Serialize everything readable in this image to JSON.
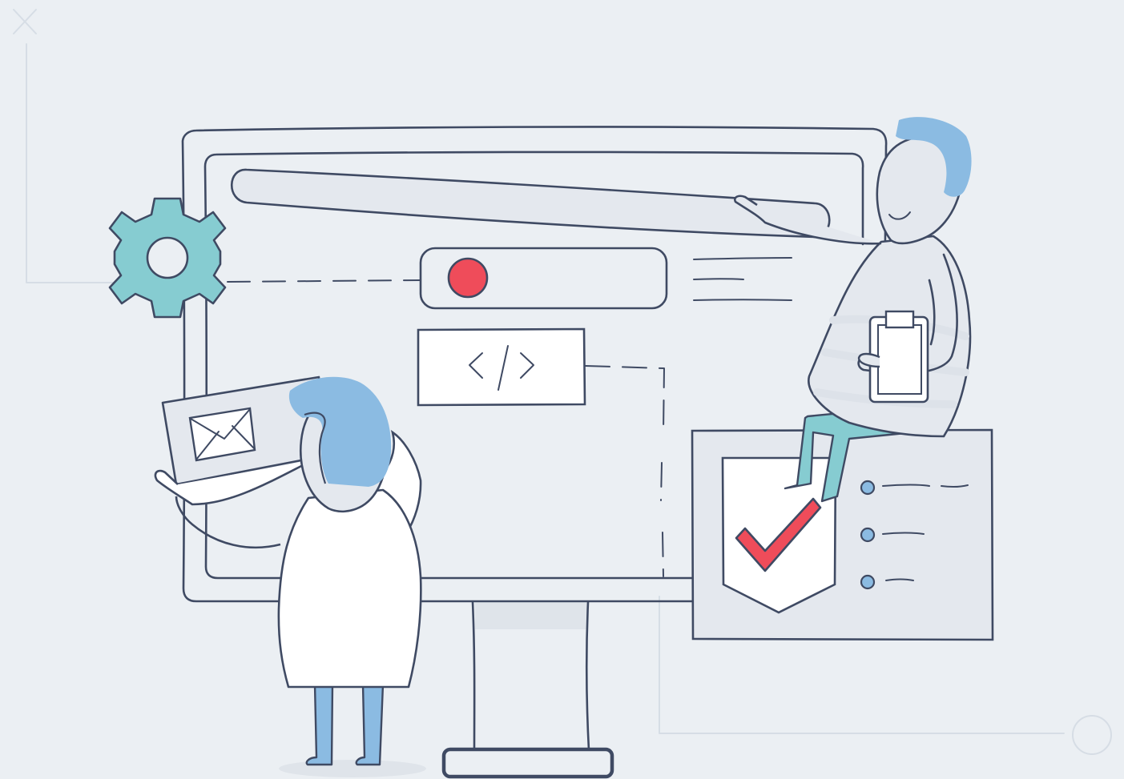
{
  "colors": {
    "background": "#ebeff3",
    "outline": "#3f4a63",
    "faint_line": "#d6dde5",
    "panel_fill": "#e4e8ee",
    "white": "#ffffff",
    "gear": "#86ccd1",
    "hair_blue": "#8bbbe2",
    "legs_blue": "#8bbbe2",
    "legs_teal": "#86ccd1",
    "record_red": "#ef4c5a",
    "check_red": "#ef4c5a",
    "bullet_blue": "#8bbbe2",
    "stripe": "#dde2e9"
  },
  "icons": [
    "close-icon",
    "gear-icon",
    "code-icon",
    "record-dot-icon",
    "envelope-icon",
    "shield-check-icon",
    "clipboard-icon",
    "circle-icon"
  ]
}
